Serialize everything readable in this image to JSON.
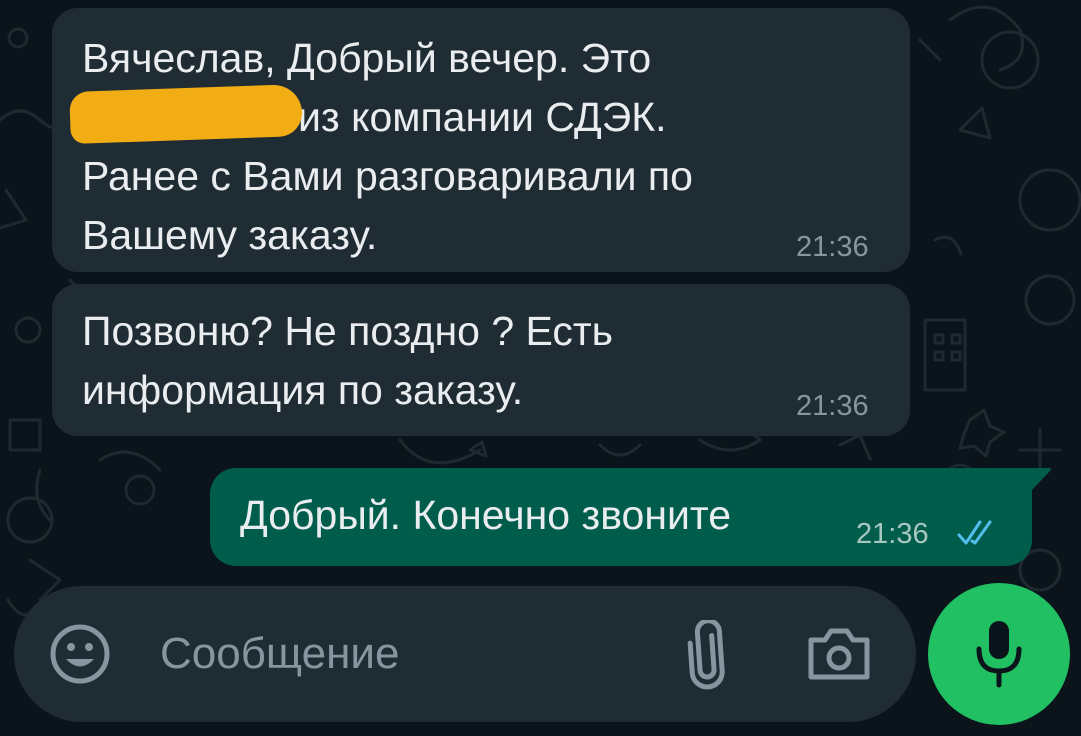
{
  "messages": [
    {
      "direction": "incoming",
      "lines": [
        "Вячеслав, Добрый вечер. Это",
        "из компании СДЭК.",
        "Ранее с Вами разговаривали по",
        "Вашему заказу."
      ],
      "time": "21:36"
    },
    {
      "direction": "incoming",
      "lines": [
        "Позвоню? Не поздно ? Есть",
        "информация по заказу."
      ],
      "time": "21:36"
    },
    {
      "direction": "outgoing",
      "lines": [
        "Добрый. Конечно звоните"
      ],
      "time": "21:36",
      "status": "read"
    }
  ],
  "composer": {
    "placeholder": "Сообщение"
  },
  "icons": {
    "emoji": "emoji-icon",
    "attach": "paperclip-icon",
    "camera": "camera-icon",
    "mic": "microphone-icon",
    "read_receipt": "double-check-icon"
  },
  "colors": {
    "background": "#0b141a",
    "incoming_bubble": "#202c33",
    "outgoing_bubble": "#005c4b",
    "accent": "#21c063",
    "read_receipt": "#53bdeb",
    "redaction": "#f2ad14"
  }
}
